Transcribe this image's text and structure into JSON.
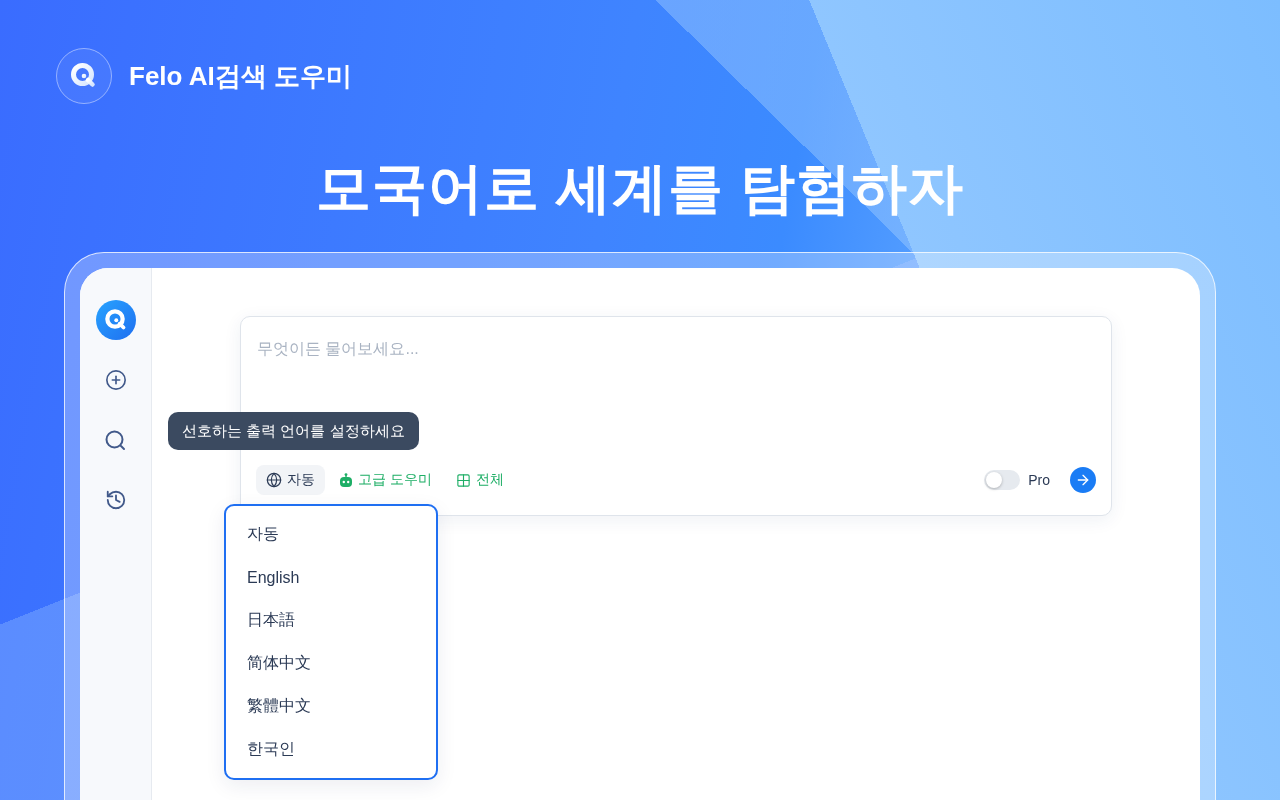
{
  "brand": {
    "name": "Felo AI검색 도우미"
  },
  "headline": "모국어로 세계를 탐험하자",
  "search_box": {
    "placeholder": "무엇이든 물어보세요...",
    "tooltip": "선호하는 출력 언어를 설정하세요",
    "tools": [
      {
        "kind": "language",
        "label": "자동"
      },
      {
        "kind": "assistant",
        "label": "고급 도우미"
      },
      {
        "kind": "scope",
        "label": "전체"
      }
    ],
    "pro_toggle": {
      "label": "Pro",
      "on": false
    }
  },
  "language_menu": {
    "items": [
      {
        "label": "자동"
      },
      {
        "label": "English"
      },
      {
        "label": "日本語"
      },
      {
        "label": "简体中文"
      },
      {
        "label": "繁體中文"
      },
      {
        "label": "한국인"
      }
    ]
  }
}
